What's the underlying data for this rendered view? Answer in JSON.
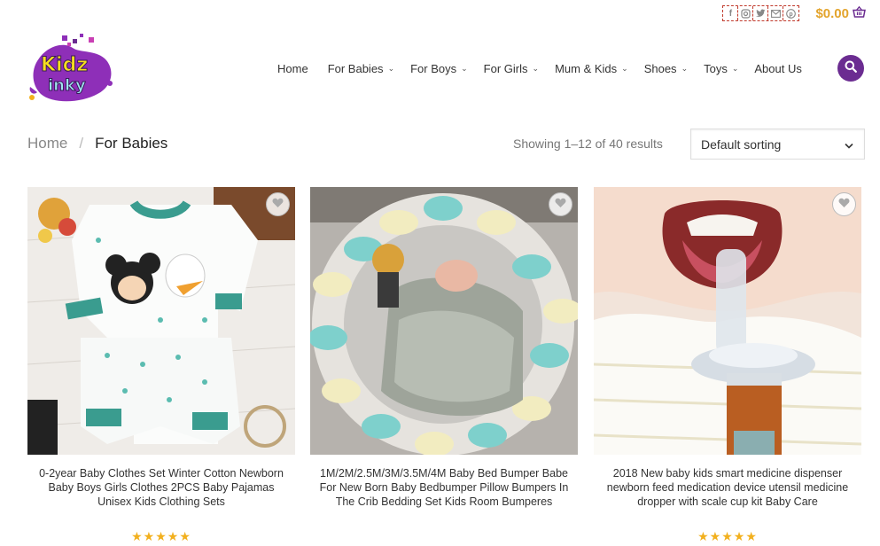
{
  "topbar": {
    "social_icons": [
      "facebook-icon",
      "instagram-icon",
      "twitter-icon",
      "email-icon",
      "pinterest-icon"
    ],
    "cart_total": "$0.00"
  },
  "logo": {
    "text": "Kidz Inky"
  },
  "nav": {
    "items": [
      {
        "label": "Home",
        "has_dropdown": false
      },
      {
        "label": "For Babies",
        "has_dropdown": true
      },
      {
        "label": "For Boys",
        "has_dropdown": true
      },
      {
        "label": "For Girls",
        "has_dropdown": true
      },
      {
        "label": "Mum & Kids",
        "has_dropdown": true
      },
      {
        "label": "Shoes",
        "has_dropdown": true
      },
      {
        "label": "Toys",
        "has_dropdown": true
      },
      {
        "label": "About Us",
        "has_dropdown": false
      }
    ]
  },
  "breadcrumb": {
    "home": "Home",
    "separator": "/",
    "current": "For Babies"
  },
  "results": {
    "text": "Showing 1–12 of 40 results"
  },
  "sorting": {
    "selected": "Default sorting"
  },
  "products": [
    {
      "title": "0-2year Baby Clothes Set Winter Cotton Newborn Baby Boys Girls Clothes 2PCS Baby Pajamas Unisex Kids Clothing Sets",
      "rating": "★★★★★"
    },
    {
      "title": "1M/2M/2.5M/3M/3.5M/4M Baby Bed Bumper Babe For New Born Baby Bedbumper Pillow Bumpers In The Crib Bedding Set Kids Room Bumperes",
      "rating": ""
    },
    {
      "title": "2018 New baby kids smart medicine dispenser newborn feed medication device utensil medicine dropper with scale cup kit Baby Care",
      "rating": "★★★★★"
    }
  ],
  "colors": {
    "accent": "#6b2c91",
    "price": "#e3a42c",
    "stars": "#f2b01e"
  }
}
